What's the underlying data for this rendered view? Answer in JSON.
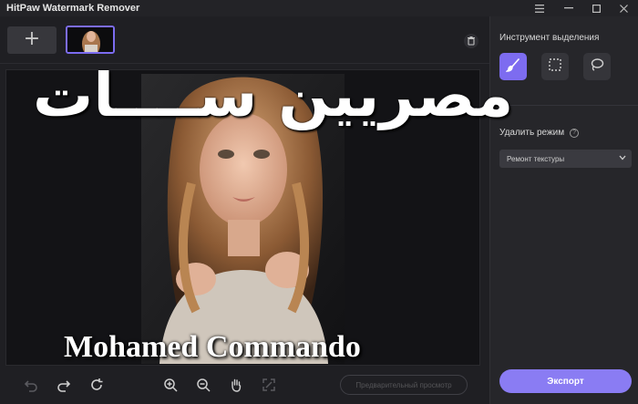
{
  "window": {
    "title": "HitPaw Watermark Remover",
    "controls": [
      {
        "name": "menu-icon",
        "glyph": "☰"
      },
      {
        "name": "minimize-icon",
        "glyph": "—"
      },
      {
        "name": "maximize-icon",
        "glyph": "☐"
      },
      {
        "name": "close-icon",
        "glyph": "✕"
      }
    ]
  },
  "thumbbar": {
    "add_label": "+",
    "add_icon": "plus-icon",
    "delete_icon": "trash-icon"
  },
  "overlay": {
    "arabic_text": "مصريين ســــات",
    "name_text": "Mohamed Commando"
  },
  "bottom_toolbar": {
    "icons": [
      "undo-icon",
      "redo-icon",
      "reset-icon",
      "zoom-in-icon",
      "zoom-out-icon",
      "hand-icon",
      "fit-screen-icon"
    ],
    "preview_label": "Предварительный просмотр"
  },
  "panel": {
    "selection_title": "Инструмент выделения",
    "tools": [
      "brush-icon",
      "rectangle-select-icon",
      "lasso-icon"
    ],
    "active_tool": "brush-icon",
    "mode_label": "Удалить режим",
    "mode_help": "?",
    "mode_value": "Ремонт текстуры",
    "export_label": "Экспорт"
  },
  "colors": {
    "accent": "#7d6cf0",
    "export": "#8a7cf3",
    "background": "#1c1c1f",
    "panel": "#26262a"
  }
}
